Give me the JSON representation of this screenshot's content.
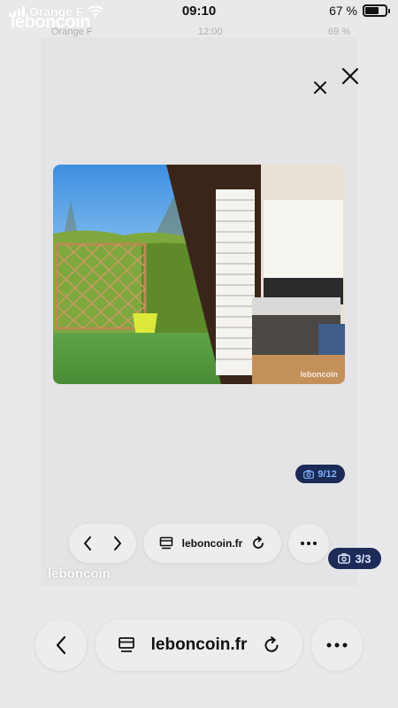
{
  "status_bar": {
    "carrier": "Orange F",
    "time": "09:10",
    "battery": "67 %",
    "watermark": "leboncoin"
  },
  "inner_screen": {
    "ghost_status": {
      "carrier": "Orange F",
      "time": "12:00",
      "battery": "69 %"
    },
    "photo_counter": "9/12",
    "photo_watermark": "leboncoin",
    "url": "leboncoin.fr",
    "watermark": "leboncoin"
  },
  "outer_gallery": {
    "photo_counter": "3/3"
  },
  "browser_bar": {
    "url": "leboncoin.fr"
  },
  "icons": {
    "close": "close-icon",
    "back": "chevron-left-icon",
    "forward": "chevron-right-icon",
    "tabs": "tabs-icon",
    "reload": "reload-icon",
    "more": "more-icon",
    "camera": "camera-icon"
  },
  "colors": {
    "counter_bg": "#1c2b57",
    "counter_text": "#7fb2ff",
    "page_bg": "#e9e9ec"
  }
}
